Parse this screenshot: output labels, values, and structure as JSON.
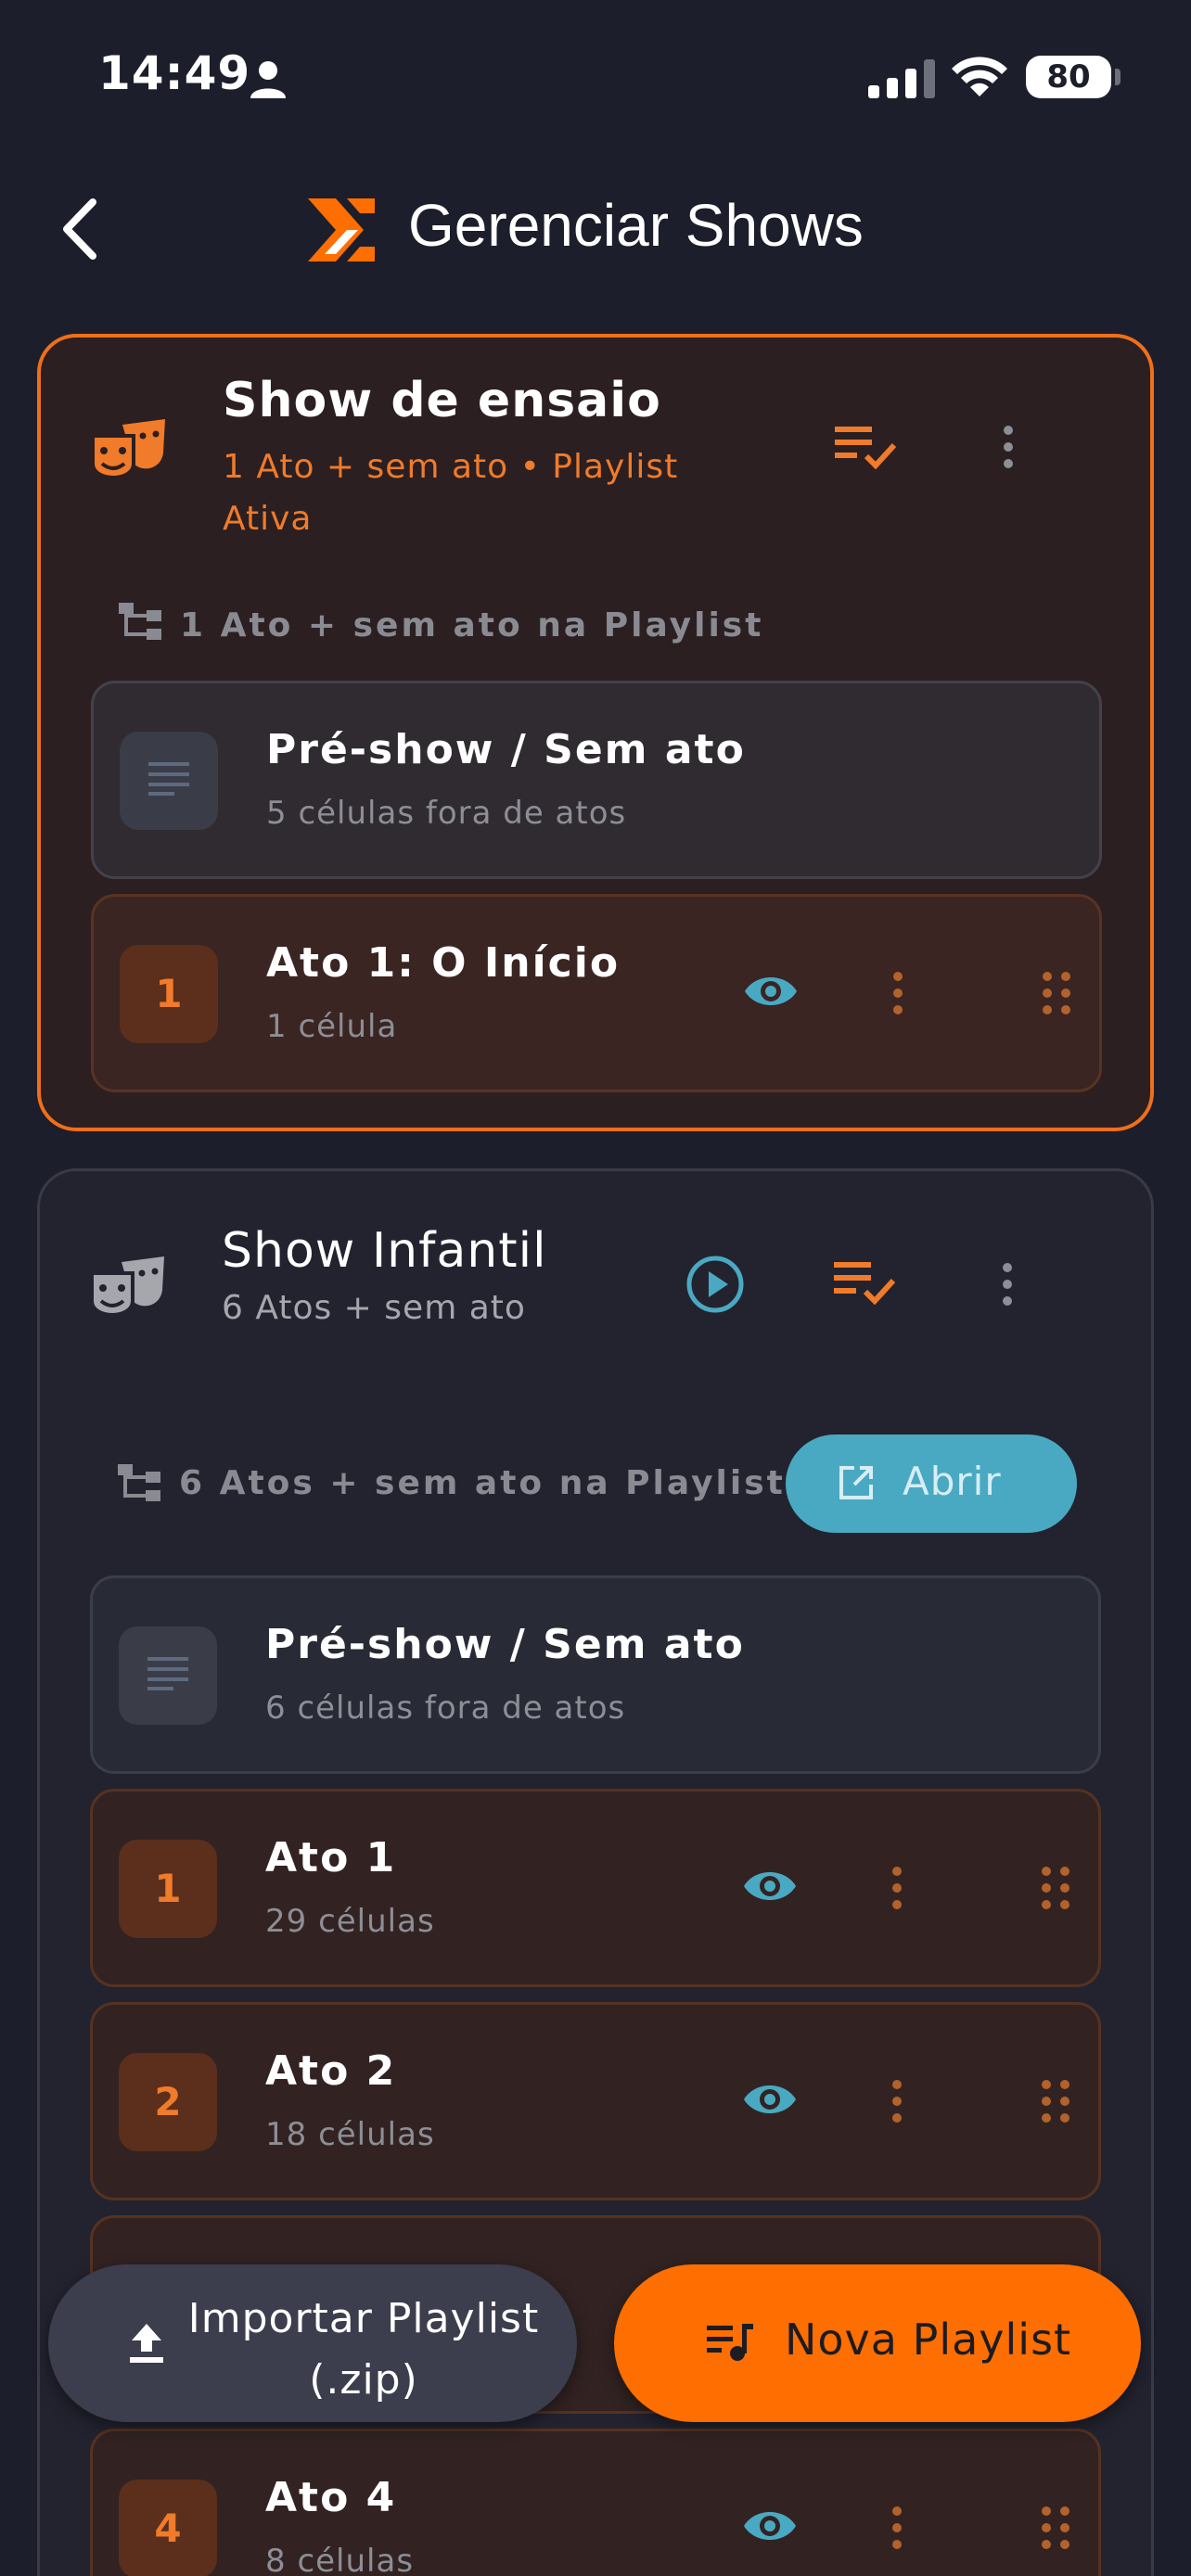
{
  "status_bar": {
    "time": "14:49",
    "battery": "80"
  },
  "header": {
    "title": "Gerenciar Shows"
  },
  "shows": [
    {
      "title": "Show de ensaio",
      "subtitle": "1 Ato + sem ato • Playlist Ativa",
      "section_label": "1 Ato + sem ato na Playlist",
      "rows": [
        {
          "title": "Pré-show / Sem ato",
          "subtitle": "5 células fora de atos"
        },
        {
          "badge": "1",
          "title": "Ato 1: O Início",
          "subtitle": "1 célula"
        }
      ]
    },
    {
      "title": "Show Infantil",
      "subtitle": "6 Atos + sem ato",
      "section_label": "6 Atos + sem ato na Playlist",
      "open_label": "Abrir",
      "rows": [
        {
          "title": "Pré-show / Sem ato",
          "subtitle": "6 células fora de atos"
        },
        {
          "badge": "1",
          "title": "Ato 1",
          "subtitle": "29 células"
        },
        {
          "badge": "2",
          "title": "Ato 2",
          "subtitle": "18 células"
        },
        {
          "badge": "4",
          "title": "Ato 4",
          "subtitle": "8 células"
        }
      ]
    }
  ],
  "fab": {
    "import_label": "Importar Playlist (.zip)",
    "new_label": "Nova Playlist"
  },
  "colors": {
    "accent": "#ff6e00",
    "teal": "#4aa9c2",
    "background": "#1d1e2b"
  }
}
